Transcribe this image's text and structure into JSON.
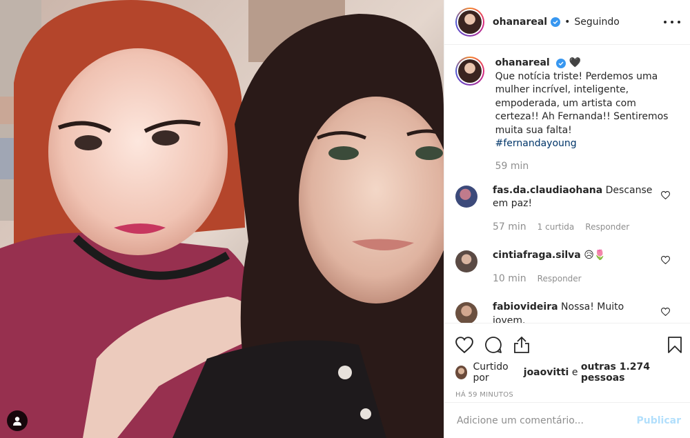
{
  "post": {
    "username": "ohanareal",
    "following_label": "Seguindo",
    "more_icon": "more-options-icon",
    "caption": {
      "username": "ohanareal",
      "emoji": "🖤",
      "text": "Que notícia triste! Perdemos uma mulher incrível, inteligente, empoderada, um artista com certeza!! Ah Fernanda!! Sentiremos muita sua falta!",
      "hashtag": "#fernandayoung",
      "time": "59 min"
    },
    "comments": [
      {
        "username": "fas.da.claudiaohana",
        "text": "Descanse em paz!",
        "time": "57 min",
        "likes": "1 curtida",
        "reply": "Responder"
      },
      {
        "username": "cintiafraga.silva",
        "text": "😥🌷",
        "time": "10 min",
        "reply": "Responder"
      },
      {
        "username": "fabiovideira",
        "text": "Nossa! Muito jovem."
      }
    ],
    "liked": {
      "prefix": "Curtido por",
      "user": "joaovitti",
      "middle": "e",
      "others": "outras 1.274 pessoas"
    },
    "timestamp": "HÁ 59 MINUTOS",
    "add_comment": {
      "placeholder": "Adicione um comentário...",
      "publish": "Publicar"
    }
  },
  "colors": {
    "link": "#003569",
    "verified": "#3897f0",
    "muted": "#8e8e8e",
    "publish_disabled": "#b2dffc"
  }
}
